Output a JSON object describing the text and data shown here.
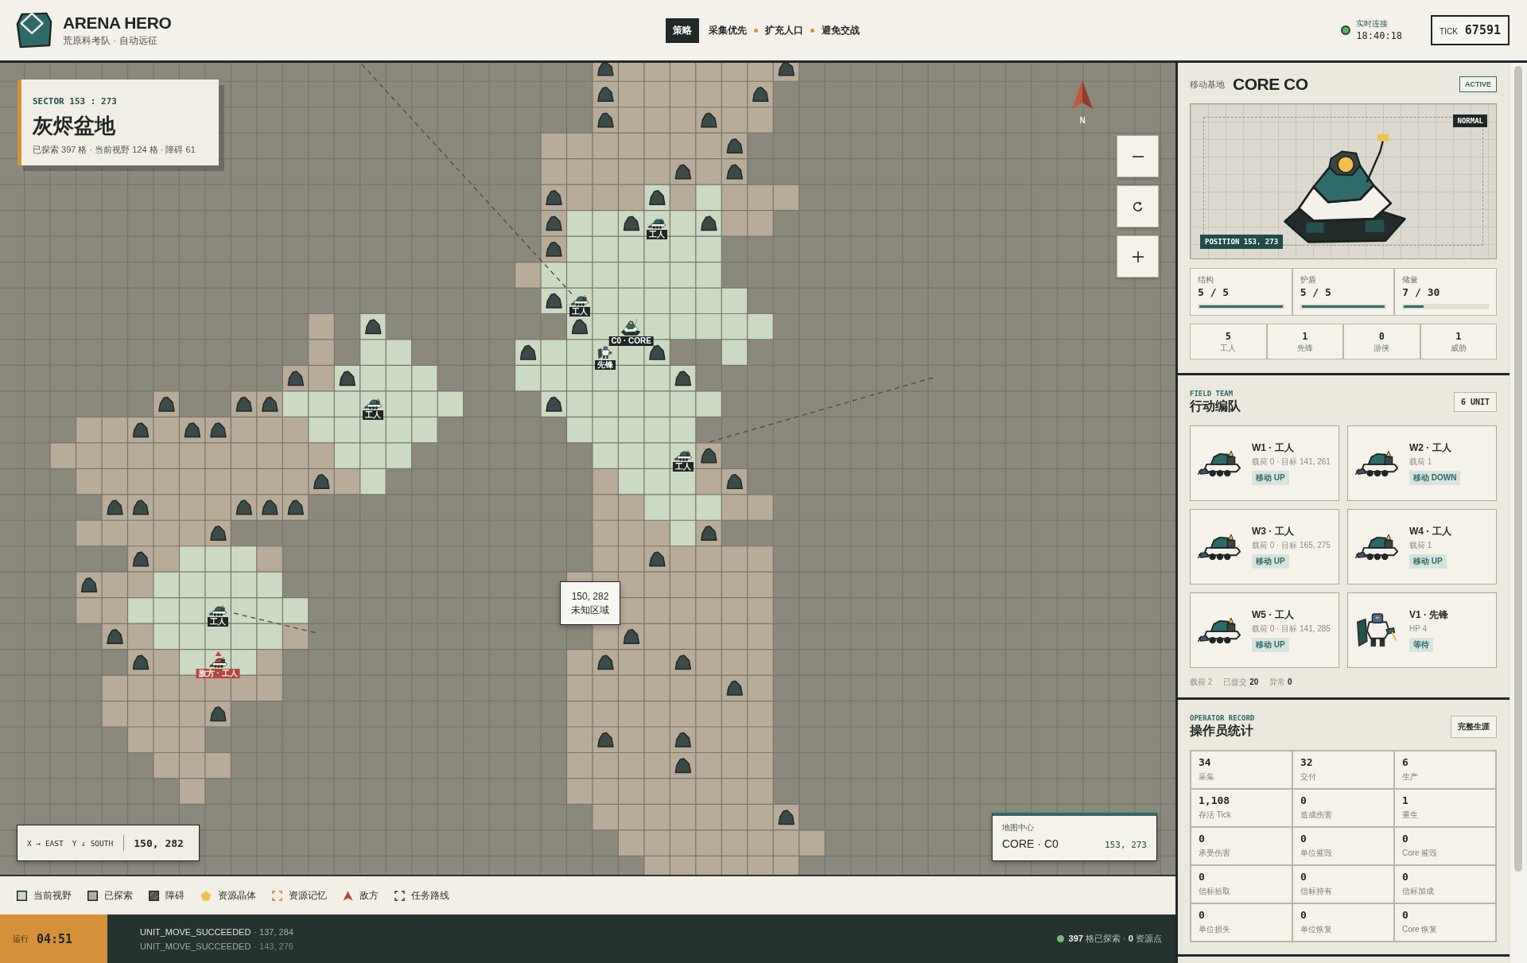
{
  "header": {
    "title": "ARENA HERO",
    "subtitle": "荒原科考队 · 自动远征",
    "strategy": {
      "label": "策略",
      "priorities": [
        "采集优先",
        "扩充人口",
        "避免交战"
      ]
    },
    "connection": {
      "label": "实时连接",
      "time": "18:40:18",
      "online": true
    },
    "tick": {
      "label": "TICK",
      "value": "67591"
    }
  },
  "map": {
    "sector": {
      "code": "SECTOR 153 : 273",
      "name": "灰烬盆地",
      "stats": "已探索 397 格 · 当前视野 124 格 · 障碍 61"
    },
    "compass": "N",
    "units": [
      {
        "kind": "worker",
        "label": "工人",
        "hostile": false
      },
      {
        "kind": "worker",
        "label": "工人",
        "hostile": false
      },
      {
        "kind": "core",
        "label": "C0 · CORE",
        "hostile": false
      },
      {
        "kind": "vanguard",
        "label": "先锋",
        "hostile": false
      },
      {
        "kind": "worker",
        "label": "工人",
        "hostile": false
      },
      {
        "kind": "worker",
        "label": "工人",
        "hostile": false
      },
      {
        "kind": "worker",
        "label": "工人",
        "hostile": false
      },
      {
        "kind": "worker",
        "label": "敌方 · 工人",
        "hostile": true
      }
    ],
    "tooltip": {
      "coords": "150, 282",
      "note": "未知区域"
    },
    "cursor": {
      "x_axis": "X → EAST",
      "y_axis": "Y ↓ SOUTH",
      "coords": "150, 282"
    },
    "center": {
      "label": "地图中心",
      "name": "CORE · C0",
      "coords": "153, 273"
    }
  },
  "legend": [
    {
      "kind": "view",
      "label": "当前视野"
    },
    {
      "kind": "explored",
      "label": "已探索"
    },
    {
      "kind": "obstacle",
      "label": "障碍"
    },
    {
      "kind": "crystal",
      "label": "资源晶体"
    },
    {
      "kind": "memory",
      "label": "资源记忆"
    },
    {
      "kind": "enemy",
      "label": "敌方"
    },
    {
      "kind": "route",
      "label": "任务路线"
    }
  ],
  "status_bar": {
    "run_label": "运行",
    "run_time": "04:51",
    "log": [
      {
        "event": "UNIT_MOVE_SUCCEEDED",
        "detail": "· 137, 284"
      },
      {
        "event": "UNIT_MOVE_SUCCEEDED",
        "detail": "· 143, 276"
      }
    ],
    "summary": "**397** 格已探索 · **0** 资源点"
  },
  "base": {
    "label": "移动基地",
    "name": "CORE CO",
    "status": "ACTIVE",
    "mode": "NORMAL",
    "position": "POSITION 153, 273",
    "gauges": [
      {
        "label": "结构",
        "reading": "5 / 5",
        "level": 1
      },
      {
        "label": "护盾",
        "reading": "5 / 5",
        "level": 1
      },
      {
        "label": "储量",
        "reading": "7 / 30",
        "level": 0.233
      }
    ],
    "counts": [
      {
        "value": "5",
        "label": "工人"
      },
      {
        "value": "1",
        "label": "先锋"
      },
      {
        "value": "0",
        "label": "游侠"
      },
      {
        "value": "1",
        "label": "威胁"
      }
    ]
  },
  "field_team": {
    "eyebrow": "FIELD TEAM",
    "title": "行动编队",
    "badge": "6 UNIT",
    "units": [
      {
        "kind": "worker",
        "name": "W1 · 工人",
        "detail": "载荷 0 · 目标 141, 261",
        "order": "移动 UP"
      },
      {
        "kind": "worker",
        "name": "W2 · 工人",
        "detail": "载荷 1",
        "order": "移动 DOWN"
      },
      {
        "kind": "worker",
        "name": "W3 · 工人",
        "detail": "载荷 0 · 目标 165, 275",
        "order": "移动 UP"
      },
      {
        "kind": "worker",
        "name": "W4 · 工人",
        "detail": "载荷 1",
        "order": "移动 UP"
      },
      {
        "kind": "worker",
        "name": "W5 · 工人",
        "detail": "载荷 0 · 目标 141, 285",
        "order": "移动 UP"
      },
      {
        "kind": "vanguard",
        "name": "V1 · 先锋",
        "detail": "HP 4",
        "order": "等待"
      }
    ],
    "summary": [
      "载荷 2",
      "已提交 **20**",
      "异常 **0**"
    ]
  },
  "record": {
    "eyebrow": "OPERATOR RECORD",
    "title": "操作员统计",
    "button": "完整生涯",
    "stats": [
      {
        "value": "34",
        "label": "采集"
      },
      {
        "value": "32",
        "label": "交付"
      },
      {
        "value": "6",
        "label": "生产"
      },
      {
        "value": "1,108",
        "label": "存活 Tick"
      },
      {
        "value": "0",
        "label": "造成伤害"
      },
      {
        "value": "1",
        "label": "重生"
      },
      {
        "value": "0",
        "label": "承受伤害"
      },
      {
        "value": "0",
        "label": "单位摧毁"
      },
      {
        "value": "0",
        "label": "Core 摧毁"
      },
      {
        "value": "0",
        "label": "信标拾取"
      },
      {
        "value": "0",
        "label": "信标持有"
      },
      {
        "value": "0",
        "label": "信标加成"
      },
      {
        "value": "0",
        "label": "单位损失"
      },
      {
        "value": "0",
        "label": "单位恢复"
      },
      {
        "value": "0",
        "label": "Core 恢复"
      }
    ]
  }
}
